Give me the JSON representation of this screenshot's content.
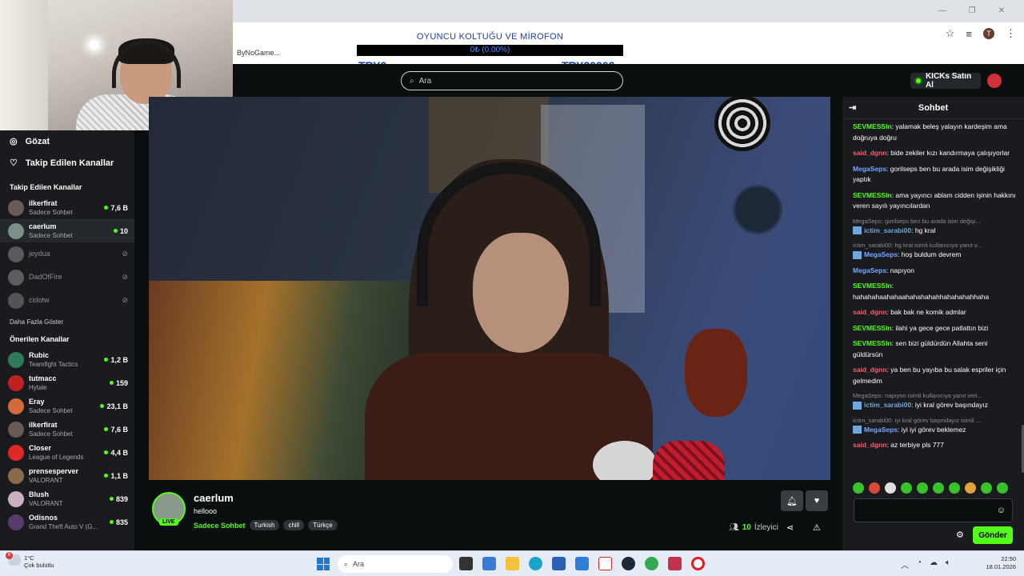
{
  "browser": {
    "bookmark": "ByNoGame...",
    "profile_initial": "T"
  },
  "donation": {
    "title": "OYUNCU KOLTUĞU VE MİROFON",
    "progress_text": "0₺ (0.00%)",
    "progress": 0,
    "min": "TRY0",
    "max": "TRY20000"
  },
  "header": {
    "search_placeholder": "Ara",
    "kicks_label": "KICKs Satın Al",
    "accent": "#53fc18"
  },
  "sidebar": {
    "nav": [
      {
        "label": "Gözat",
        "icon": "compass-icon"
      },
      {
        "label": "Takip Edilen Kanallar",
        "icon": "heart-icon"
      }
    ],
    "followed_title": "Takip Edilen Kanallar",
    "followed": [
      {
        "name": "ilkerfirat",
        "category": "Sadece Sohbet",
        "viewers": "7,6 B",
        "live": true
      },
      {
        "name": "caerlum",
        "category": "Sadece Sohbet",
        "viewers": "10",
        "live": true,
        "active": true
      },
      {
        "name": "jeydua",
        "live": false
      },
      {
        "name": "DadOfFire",
        "live": false
      },
      {
        "name": "cidotw",
        "live": false
      }
    ],
    "show_more": "Daha Fazla Göster",
    "recommended_title": "Önerilen Kanallar",
    "recommended": [
      {
        "name": "Rubic",
        "category": "Teamfight Tactics",
        "viewers": "1,2 B"
      },
      {
        "name": "tutmacc",
        "category": "Hytale",
        "viewers": "159"
      },
      {
        "name": "Eray",
        "category": "Sadece Sohbet",
        "viewers": "23,1 B"
      },
      {
        "name": "ilkerfirat",
        "category": "Sadece Sohbet",
        "viewers": "7,6 B"
      },
      {
        "name": "Closer",
        "category": "League of Legends",
        "viewers": "4,4 B"
      },
      {
        "name": "prensesperver",
        "category": "VALORANT",
        "viewers": "1,1 B"
      },
      {
        "name": "Blush",
        "category": "VALORANT",
        "viewers": "839"
      },
      {
        "name": "Odisnos",
        "category": "Grand Theft Auto V (G...",
        "viewers": "835"
      }
    ]
  },
  "stream": {
    "channel": "caerlum",
    "title": "hellooo",
    "live_badge": "LIVE",
    "category": "Sadece Sohbet",
    "tags": [
      "Turkish",
      "chill",
      "Türkçe"
    ],
    "viewers": "10",
    "viewers_label": "İzleyici"
  },
  "chat": {
    "title": "Sohbet",
    "messages": [
      {
        "user": "SEVMESSIn",
        "color": "#53fc18",
        "text": "yalamak beleş yalayın kardeşim ama doğruya doğru"
      },
      {
        "user": "said_dgnn",
        "color": "#ff5c6c",
        "text": "bide zekiler kızı kandırmaya çalışıyorlar"
      },
      {
        "user": "MegaSeps",
        "color": "#7aa7ff",
        "text": "gorilseps ben bu arada isim değişikliği yaptık"
      },
      {
        "user": "SEVMESSIn",
        "color": "#53fc18",
        "text": "ama yayıncı ablam cidden işinin hakkını veren sayılı yayıncılardan"
      },
      {
        "reply": "MegaSeps: gorilseps ben bu arada isim değişi...",
        "user": "ictim_sarabi00",
        "color": "#6fa8dc",
        "text": "hg kral"
      },
      {
        "reply": "ictim_sarabi00: hg kral isimli kullanıcıya yanıt v...",
        "user": "MegaSeps",
        "color": "#7aa7ff",
        "text": "hoş buldum devrem"
      },
      {
        "user": "MegaSeps",
        "color": "#7aa7ff",
        "text": "napıyon"
      },
      {
        "user": "SEVMESSIn",
        "color": "#53fc18",
        "text": "hahahahaahahaahahahahahhahahahahhaha"
      },
      {
        "user": "said_dgnn",
        "color": "#ff5c6c",
        "text": "bak bak ne komik admlar"
      },
      {
        "user": "SEVMESSIn",
        "color": "#53fc18",
        "text": "ilahi ya gece gece patlattın bizi"
      },
      {
        "user": "SEVMESSIn",
        "color": "#53fc18",
        "text": "sen bizi güldürdün Allahta seni güldürsün"
      },
      {
        "user": "said_dgnn",
        "color": "#ff5c6c",
        "text": "ya ben bu yayıba bu salak espriler için gelmedim"
      },
      {
        "reply": "MegaSeps: napıyon isimli kullanıcıya yanıt veri...",
        "user": "ictim_sarabi00",
        "color": "#6fa8dc",
        "text": "iyi kral görev başındayız"
      },
      {
        "reply": "ictim_sarabi00: iyi kral görev başındayız isimli ...",
        "user": "MegaSeps",
        "color": "#7aa7ff",
        "text": "iyi iyi görev beklemez"
      },
      {
        "user": "said_dgnn",
        "color": "#ff5c6c",
        "text": "az terbiye pls 777"
      }
    ],
    "send_label": "Gönder"
  },
  "taskbar": {
    "weather_badge": "6",
    "temperature": "1°C",
    "weather_desc": "Çok bulutlu",
    "search_placeholder": "Ara",
    "time": "22:50",
    "date": "18.01.2026"
  }
}
